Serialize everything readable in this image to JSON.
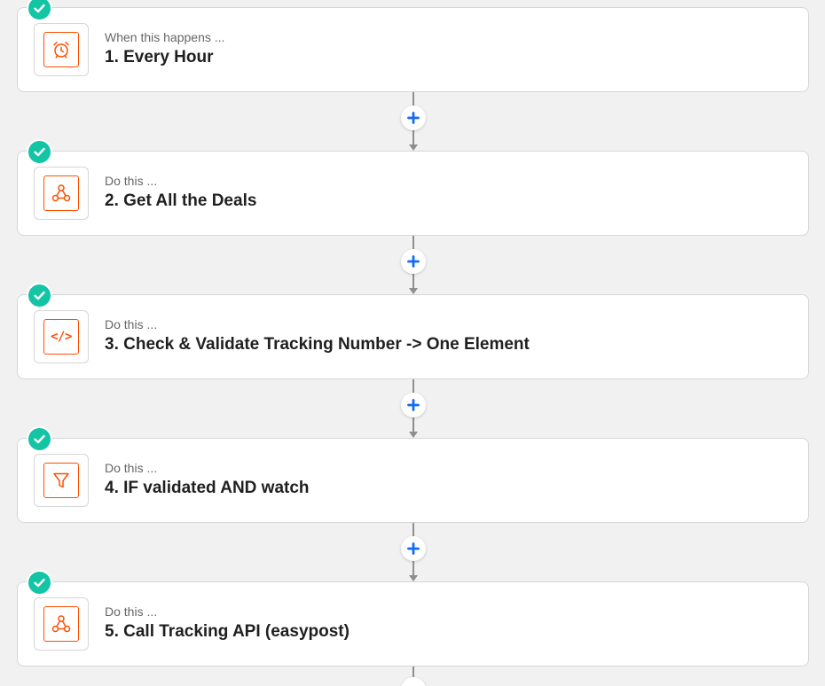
{
  "colors": {
    "background": "#f1f1f1",
    "card": "#ffffff",
    "check": "#13c5a4",
    "accent": "#ff4f00",
    "plus": "#136bf5",
    "connector": "#8e8e8e"
  },
  "steps": [
    {
      "kind": "When this happens ...",
      "title": "1. Every Hour",
      "icon": "alarm-clock-icon",
      "status": "complete"
    },
    {
      "kind": "Do this ...",
      "title": "2. Get All the Deals",
      "icon": "webhook-icon",
      "status": "complete"
    },
    {
      "kind": "Do this ...",
      "title": "3. Check & Validate Tracking Number -> One Element",
      "icon": "code-icon",
      "code_glyph": "</>",
      "status": "complete"
    },
    {
      "kind": "Do this ...",
      "title": "4. IF validated AND watch",
      "icon": "filter-icon",
      "status": "complete"
    },
    {
      "kind": "Do this ...",
      "title": "5. Call Tracking API (easypost)",
      "icon": "webhook-icon",
      "status": "complete"
    }
  ],
  "connectors": [
    {
      "action": "add-step",
      "icon": "plus-icon"
    },
    {
      "action": "add-step",
      "icon": "plus-icon"
    },
    {
      "action": "add-step",
      "icon": "plus-icon"
    },
    {
      "action": "add-step",
      "icon": "plus-icon"
    }
  ]
}
